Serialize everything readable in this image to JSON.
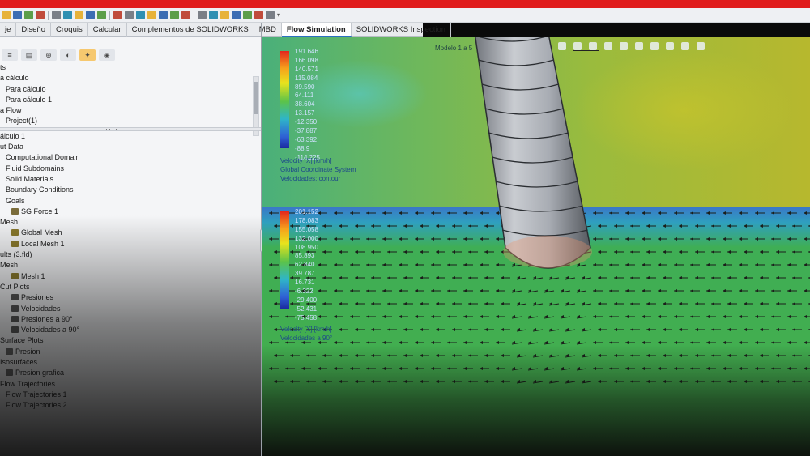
{
  "toolbar": {
    "icons": [
      "new-icon",
      "open-icon",
      "save-icon",
      "print-icon",
      "undo-icon",
      "select-icon",
      "rebuild-icon",
      "options-icon",
      "play-icon",
      "flow-run-icon",
      "flow-results-icon",
      "flow-project-icon",
      "flow-goals-icon",
      "flow-mesh-icon",
      "hide-icon",
      "show-icon",
      "view-icon",
      "zoom-icon",
      "rotate-icon",
      "section-icon",
      "appearance-icon",
      "display-icon",
      "render-icon"
    ],
    "colors": [
      "#e7b23a",
      "#3c6db3",
      "#5c9e49",
      "#c04b3b",
      "#7a7f87",
      "#2f8fb2"
    ]
  },
  "tabs": [
    {
      "label": "je",
      "active": false
    },
    {
      "label": "Diseño",
      "active": false
    },
    {
      "label": "Croquis",
      "active": false
    },
    {
      "label": "Calcular",
      "active": false
    },
    {
      "label": "Complementos de SOLIDWORKS",
      "active": false
    },
    {
      "label": "MBD",
      "active": false
    },
    {
      "label": "Flow Simulation",
      "active": true
    },
    {
      "label": "SOLIDWORKS Inspection",
      "active": false
    }
  ],
  "left_panel": {
    "tool_buttons": [
      "feature-manager-icon",
      "property-manager-icon",
      "configuration-manager-icon",
      "appearance-icon",
      "flow-analysis-icon",
      "display-manager-icon"
    ],
    "top_tree": [
      {
        "label": "ts",
        "indent": 0
      },
      {
        "label": "a cálculo",
        "indent": 0
      },
      {
        "label": "Para cálculo",
        "indent": 1
      },
      {
        "label": "Para cálculo 1",
        "indent": 1
      },
      {
        "label": "a Flow",
        "indent": 0
      },
      {
        "label": "Project(1)",
        "indent": 1
      }
    ],
    "splitter_dots": "····",
    "bottom_tree": [
      {
        "label": "álculo 1",
        "indent": 0,
        "icon": ""
      },
      {
        "label": "ut Data",
        "indent": 0,
        "icon": ""
      },
      {
        "label": "Computational Domain",
        "indent": 1,
        "icon": ""
      },
      {
        "label": "Fluid Subdomains",
        "indent": 1,
        "icon": ""
      },
      {
        "label": "Solid Materials",
        "indent": 1,
        "icon": ""
      },
      {
        "label": "Boundary Conditions",
        "indent": 1,
        "icon": ""
      },
      {
        "label": "Goals",
        "indent": 1,
        "icon": ""
      },
      {
        "label": "SG Force 1",
        "indent": 2,
        "icon": "goal"
      },
      {
        "label": "Mesh",
        "indent": 0,
        "icon": ""
      },
      {
        "label": "Global Mesh",
        "indent": 2,
        "icon": "mesh"
      },
      {
        "label": "Local Mesh 1",
        "indent": 2,
        "icon": "mesh"
      },
      {
        "label": "ults (3.fld)",
        "indent": 0,
        "icon": ""
      },
      {
        "label": "Mesh",
        "indent": 0,
        "icon": ""
      },
      {
        "label": "Mesh 1",
        "indent": 2,
        "icon": "mesh"
      },
      {
        "label": "Cut Plots",
        "indent": 0,
        "icon": ""
      },
      {
        "label": "Presiones",
        "indent": 2,
        "icon": "cut"
      },
      {
        "label": "Velocidades",
        "indent": 2,
        "icon": "cut"
      },
      {
        "label": "Presiones a 90°",
        "indent": 2,
        "icon": "cut"
      },
      {
        "label": "Velocidades a 90°",
        "indent": 2,
        "icon": "cut"
      },
      {
        "label": "Surface Plots",
        "indent": 0,
        "icon": ""
      },
      {
        "label": "Presion",
        "indent": 1,
        "icon": "surf"
      },
      {
        "label": "Isosurfaces",
        "indent": 0,
        "icon": ""
      },
      {
        "label": "Presion grafica",
        "indent": 1,
        "icon": "surf"
      },
      {
        "label": "Flow Trajectories",
        "indent": 0,
        "icon": ""
      },
      {
        "label": "Flow Trajectories 1",
        "indent": 1,
        "icon": ""
      },
      {
        "label": "Flow Trajectories 2",
        "indent": 1,
        "icon": ""
      }
    ]
  },
  "viewport": {
    "tag_label": "Modelo 1 a 5",
    "legend_top": {
      "values": [
        "191.646",
        "166.098",
        "140.571",
        "115.084",
        "89.590",
        "64.111",
        "38.604",
        "13.157",
        "-12.350",
        "-37.887",
        "-63.392",
        "-88.9",
        "-114.225"
      ],
      "captions": [
        "Velocity [X] [km/h]",
        "Global Coordinate System",
        "Velocidades: contour"
      ]
    },
    "legend_bottom": {
      "values": [
        "201.152",
        "178.083",
        "155.058",
        "132.000",
        "108.950",
        "85.893",
        "62.840",
        "39.787",
        "16.731",
        "-6.322",
        "-29.400",
        "-52.431",
        "-75.458"
      ],
      "captions": [
        "Velocity [X] [km/h]",
        "Velocidades a 90°"
      ]
    },
    "colors": {
      "red": "#e3261e",
      "yellow": "#e8e31d",
      "green": "#3fae55",
      "blue": "#2f61d5"
    }
  }
}
